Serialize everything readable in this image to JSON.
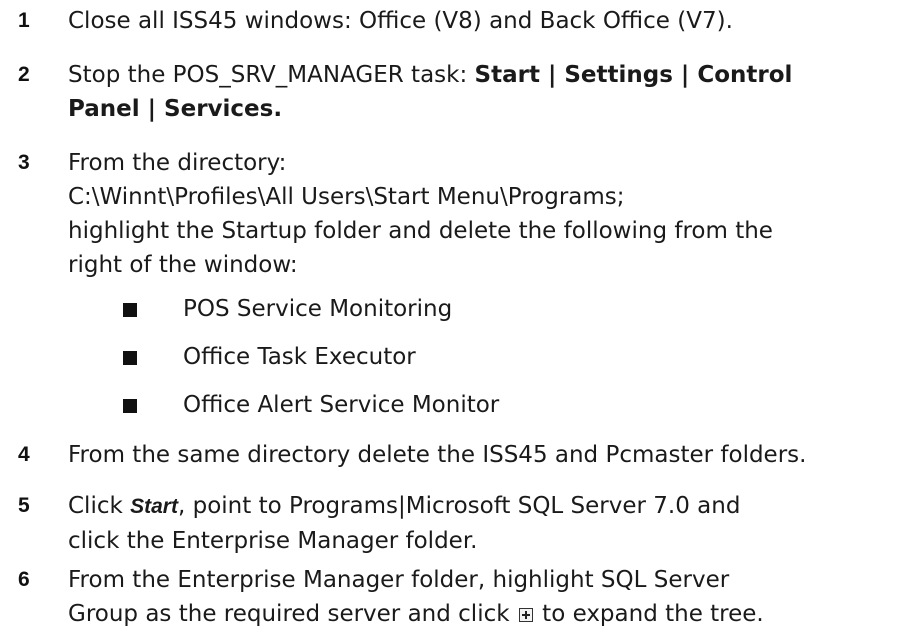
{
  "steps": [
    {
      "number": "1",
      "line1": "Close all ISS45 windows: Office (V8) and Back Office (V7)."
    },
    {
      "number": "2",
      "line1_text": "Stop the POS_SRV_MANAGER task: ",
      "line1_bold": "Start | Settings | Control",
      "line2_bold": "Panel | Services."
    },
    {
      "number": "3",
      "line1": "From the directory:",
      "line2": "C:\\Winnt\\Profiles\\All Users\\Start Menu\\Programs;",
      "line3": "highlight the Startup folder and delete the following from the",
      "line4": "right of the window:",
      "bullets": [
        "POS Service Monitoring",
        "Office Task Executor",
        "Office Alert Service Monitor"
      ]
    },
    {
      "number": "4",
      "line1": "From the same directory delete the ISS45 and Pcmaster folders."
    },
    {
      "number": "5",
      "line1_pre": "Click ",
      "line1_em": "Start",
      "line1_post": ", point to Programs|Microsoft SQL Server 7.0 and",
      "line2": "click the Enterprise Manager folder."
    },
    {
      "number": "6",
      "line1": "From the Enterprise Manager folder, highlight SQL Server",
      "line2_pre": "Group as the required server and click ",
      "line2_post": " to expand the tree."
    }
  ],
  "icons": {
    "expand": "plus-box-icon"
  }
}
